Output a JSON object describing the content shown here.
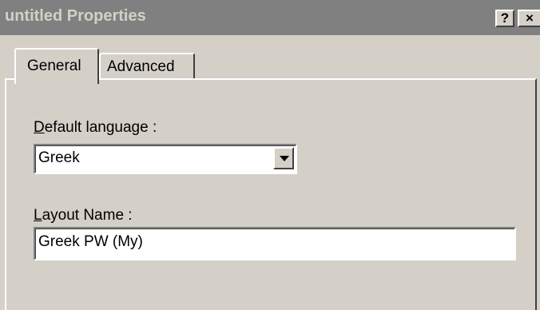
{
  "window": {
    "title": "untitled Properties",
    "help_label": "?",
    "close_label": "×"
  },
  "tabs": [
    {
      "label": "General",
      "selected": true
    },
    {
      "label": "Advanced",
      "selected": false
    }
  ],
  "general": {
    "default_language": {
      "label_mnemonic": "D",
      "label_rest": "efault language :",
      "value": "Greek"
    },
    "layout_name": {
      "label_mnemonic": "L",
      "label_rest": "ayout Name :",
      "value": "Greek PW (My)"
    }
  },
  "icons": {
    "dropdown": "chevron-down-icon"
  },
  "colors": {
    "face": "#d4d0c8",
    "titlebar_inactive": "#808080",
    "field_bg": "#ffffff"
  }
}
